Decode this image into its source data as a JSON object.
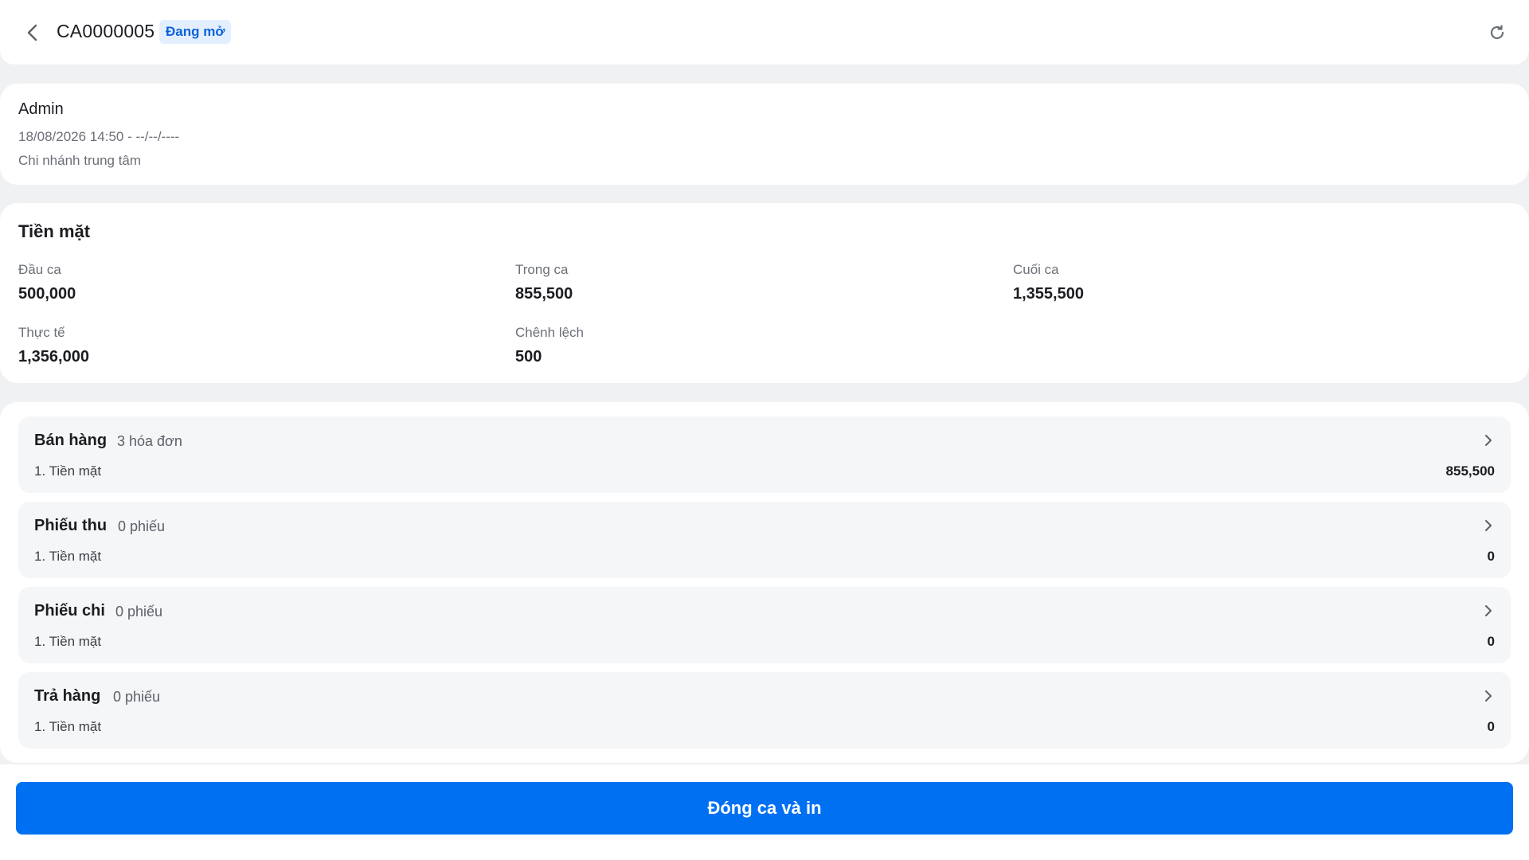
{
  "header": {
    "shift_code": "CA0000005",
    "status": "Đang mở"
  },
  "shift_info": {
    "user": "Admin",
    "time_range": "18/08/2026 14:50 - --/--/----",
    "branch": "Chi nhánh trung tâm"
  },
  "cash": {
    "title": "Tiền mặt",
    "opening_label": "Đầu ca",
    "opening_value": "500,000",
    "during_label": "Trong ca",
    "during_value": "855,500",
    "closing_label": "Cuối ca",
    "closing_value": "1,355,500",
    "actual_label": "Thực tế",
    "actual_value": "1,356,000",
    "difference_label": "Chênh lệch",
    "difference_value": "500"
  },
  "groups": [
    {
      "title": "Bán hàng",
      "count": "3 hóa đơn",
      "line_label": "1. Tiền mặt",
      "line_amount": "855,500"
    },
    {
      "title": "Phiếu thu",
      "count": "0 phiếu",
      "line_label": "1. Tiền mặt",
      "line_amount": "0"
    },
    {
      "title": "Phiếu chi",
      "count": "0 phiếu",
      "line_label": "1. Tiền mặt",
      "line_amount": "0"
    },
    {
      "title": "Trả hàng",
      "count": "0 phiếu",
      "line_label": "1. Tiền mặt",
      "line_amount": "0"
    }
  ],
  "footer": {
    "close_button": "Đóng ca và in"
  },
  "icons": {
    "back": "chevron-left-icon",
    "refresh": "refresh-icon",
    "group_chevron": "chevron-right-icon"
  },
  "colors": {
    "primary": "#0070f3",
    "badge_bg": "#e3efff",
    "badge_text": "#0a63d8",
    "background": "#f0f1f3"
  }
}
